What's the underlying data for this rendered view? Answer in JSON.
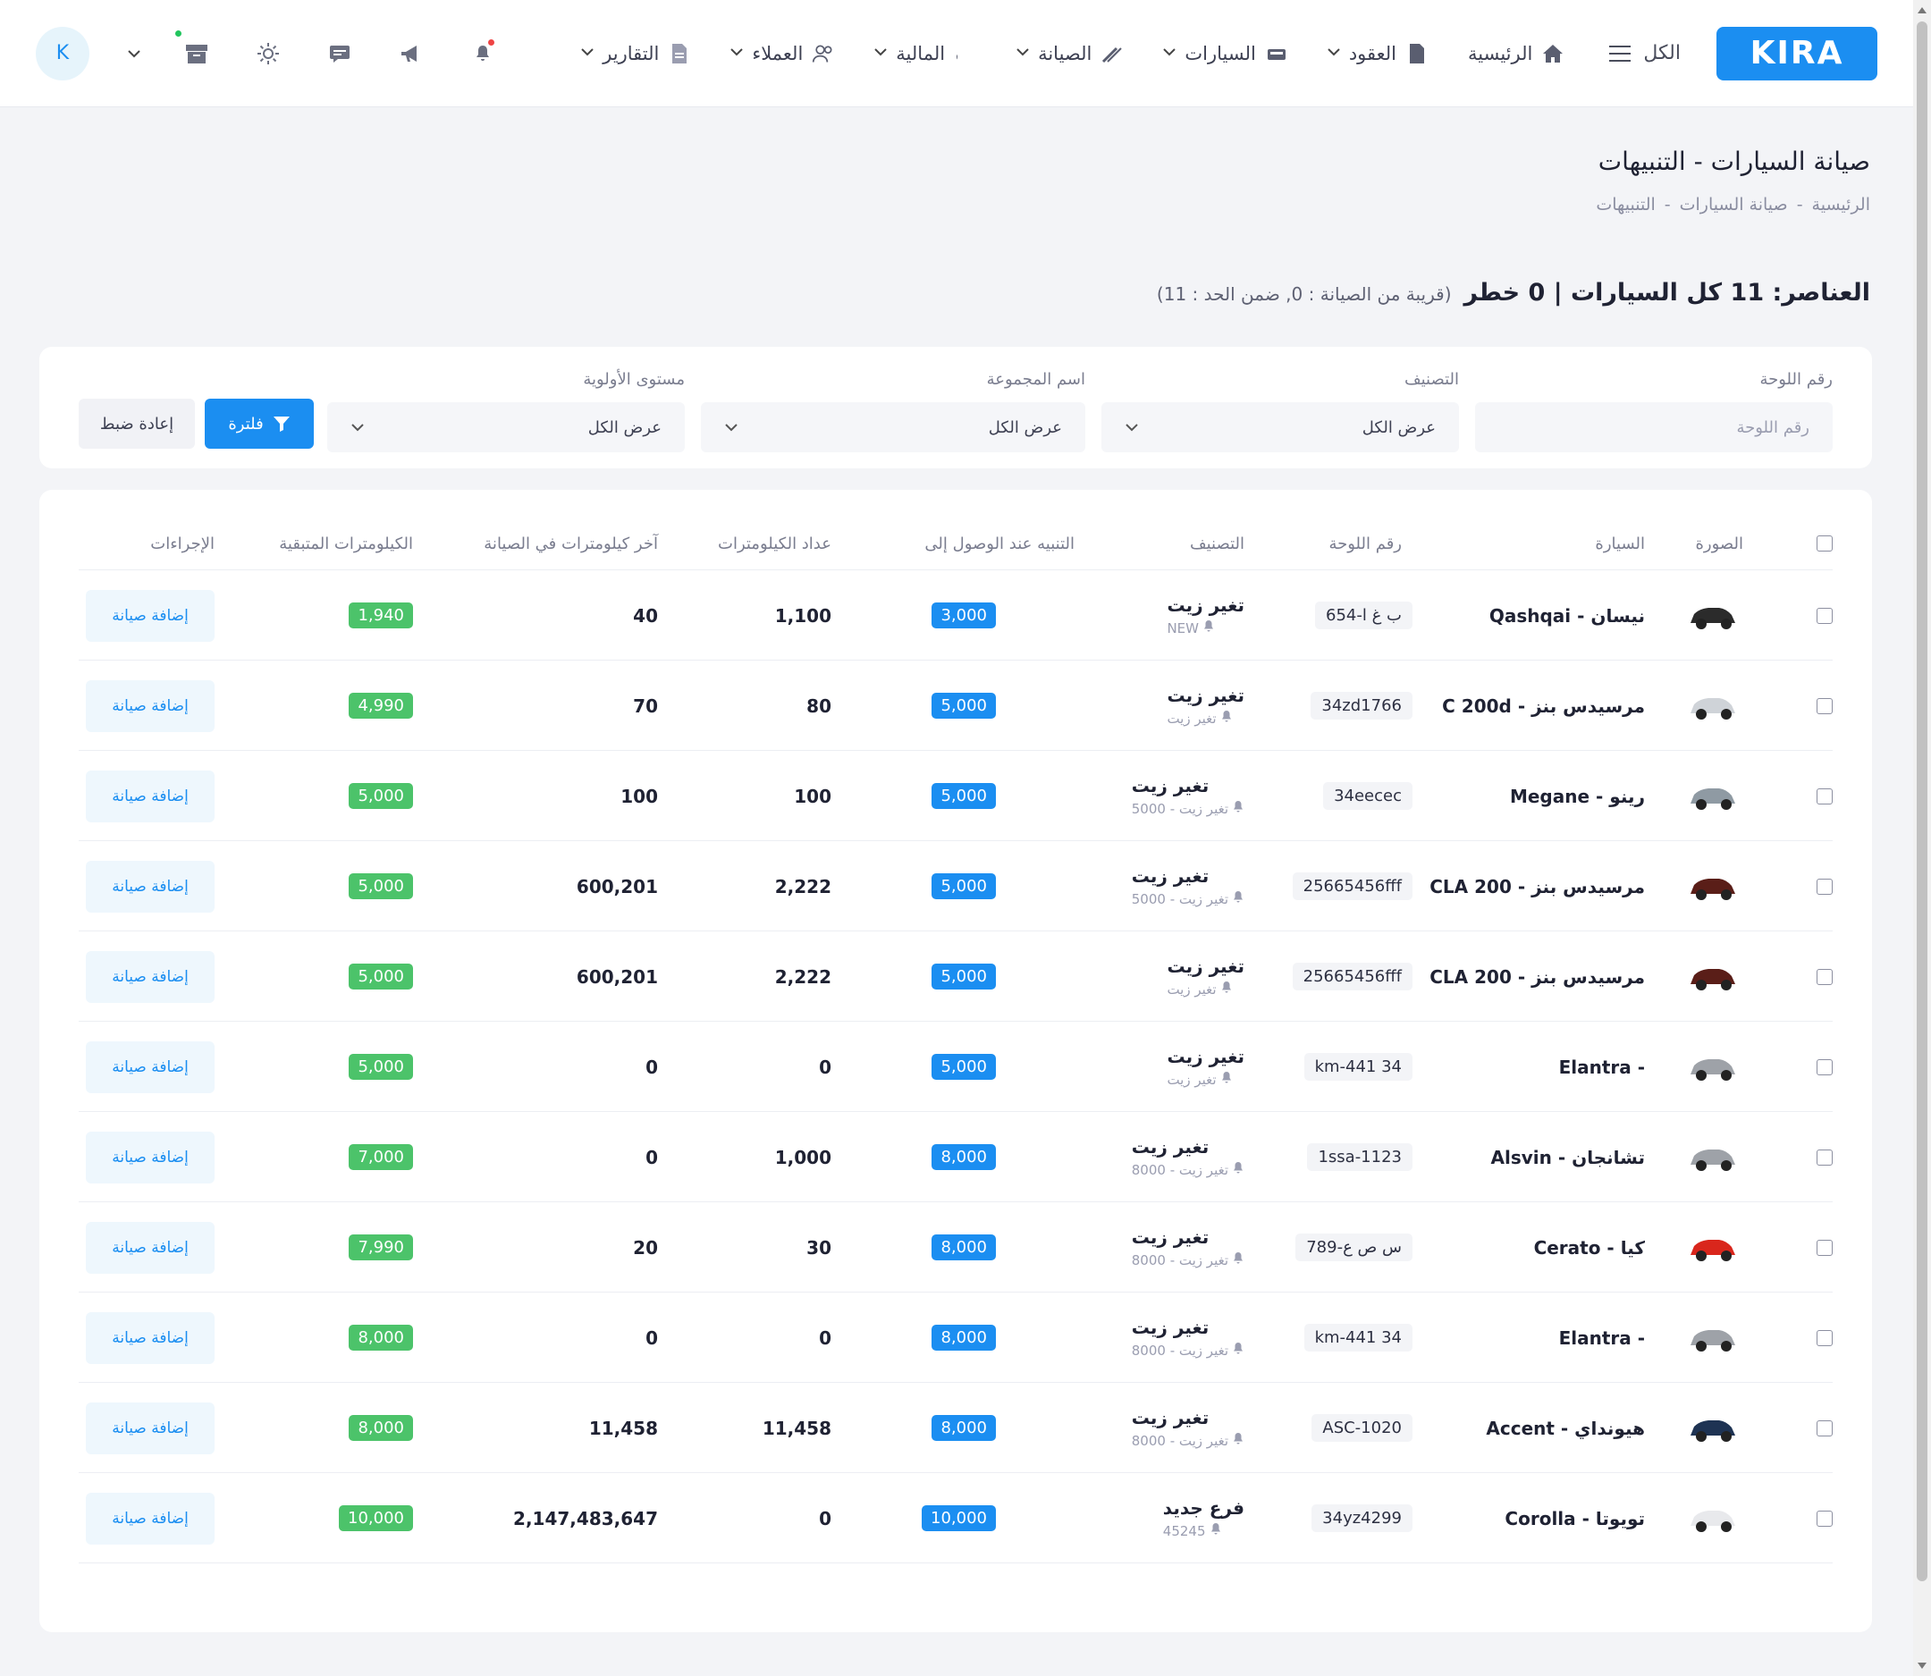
{
  "brand": {
    "logo": "KIRA",
    "accent": "#1b8ef1",
    "green": "#4cc36a"
  },
  "nav": {
    "all_label": "الكل",
    "items": [
      {
        "label": "الرئيسية",
        "icon": "home-icon",
        "has_menu": false
      },
      {
        "label": "العقود",
        "icon": "document-icon",
        "has_menu": true
      },
      {
        "label": "السيارات",
        "icon": "car-icon",
        "has_menu": true
      },
      {
        "label": "الصيانة",
        "icon": "wrench-icon",
        "has_menu": true
      },
      {
        "label": "المالية",
        "icon": "dollar-icon",
        "has_menu": true
      },
      {
        "label": "العملاء",
        "icon": "users-icon",
        "has_menu": true
      },
      {
        "label": "التقارير",
        "icon": "report-icon",
        "has_menu": true
      }
    ],
    "avatar_letter": "K"
  },
  "header": {
    "title": "صيانة السيارات - التنبيهات",
    "breadcrumb": [
      "الرئيسية",
      "صيانة السيارات",
      "التنبيهات"
    ],
    "breadcrumb_sep": "-",
    "summary_main": "العناصر: 11 كل السيارات | 0 خطر",
    "summary_sub": "(قريبة من الصيانة : 0, ضمن الحد : 11)"
  },
  "filters": {
    "plate": {
      "label": "رقم اللوحة",
      "placeholder": "رقم اللوحة"
    },
    "category": {
      "label": "التصنيف",
      "value": "عرض الكل"
    },
    "group": {
      "label": "اسم المجموعة",
      "value": "عرض الكل"
    },
    "priority": {
      "label": "مستوى الأولوية",
      "value": "عرض الكل"
    },
    "filter_button": "فلترة",
    "reset_button": "إعادة ضبط"
  },
  "table": {
    "columns": {
      "image": "الصورة",
      "car": "السيارة",
      "plate": "رقم اللوحة",
      "category": "التصنيف",
      "alert_at": "التنبيه عند الوصول إلى",
      "odometer": "عداد الكيلومترات",
      "last_service": "آخر كيلومترات في الصيانة",
      "remaining": "الكيلومترات المتبقية",
      "actions": "الإجراءات"
    },
    "action_label": "إضافة صيانة",
    "rows": [
      {
        "car": "نيسان - Qashqai",
        "plate": "ب غ ا-654",
        "cat": "تغير زيت",
        "sub": "NEW",
        "alert": "3,000",
        "odo": "1,100",
        "last": "40",
        "remain": "1,940",
        "color": "#2b2b2b"
      },
      {
        "car": "مرسيدس بنز - C 200d",
        "plate": "34zd1766",
        "cat": "تغير زيت",
        "sub": "تغير زيت",
        "alert": "5,000",
        "odo": "80",
        "last": "70",
        "remain": "4,990",
        "color": "#cfd3d8"
      },
      {
        "car": "رينو - Megane",
        "plate": "34eecec",
        "cat": "تغير زيت",
        "sub": "تغير زيت - 5000",
        "alert": "5,000",
        "odo": "100",
        "last": "100",
        "remain": "5,000",
        "color": "#8f9aa3"
      },
      {
        "car": "مرسيدس بنز - CLA 200",
        "plate": "25665456fff",
        "cat": "تغير زيت",
        "sub": "تغير زيت - 5000",
        "alert": "5,000",
        "odo": "2,222",
        "last": "600,201",
        "remain": "5,000",
        "color": "#5a1e18"
      },
      {
        "car": "مرسيدس بنز - CLA 200",
        "plate": "25665456fff",
        "cat": "تغير زيت",
        "sub": "تغير زيت",
        "alert": "5,000",
        "odo": "2,222",
        "last": "600,201",
        "remain": "5,000",
        "color": "#5a1e18"
      },
      {
        "car": "- Elantra",
        "plate": "km-441 34",
        "cat": "تغير زيت",
        "sub": "تغير زيت",
        "alert": "5,000",
        "odo": "0",
        "last": "0",
        "remain": "5,000",
        "color": "#9ea2a8"
      },
      {
        "car": "تشانجان - Alsvin",
        "plate": "1ssa-1123",
        "cat": "تغير زيت",
        "sub": "تغير زيت - 8000",
        "alert": "8,000",
        "odo": "1,000",
        "last": "0",
        "remain": "7,000",
        "color": "#9ea2a8"
      },
      {
        "car": "كيا - Cerato",
        "plate": "س ص ع-789",
        "cat": "تغير زيت",
        "sub": "تغير زيت - 8000",
        "alert": "8,000",
        "odo": "30",
        "last": "20",
        "remain": "7,990",
        "color": "#d9261c"
      },
      {
        "car": "- Elantra",
        "plate": "km-441 34",
        "cat": "تغير زيت",
        "sub": "تغير زيت - 8000",
        "alert": "8,000",
        "odo": "0",
        "last": "0",
        "remain": "8,000",
        "color": "#9ea2a8"
      },
      {
        "car": "هيونداي - Accent",
        "plate": "ASC-1020",
        "cat": "تغير زيت",
        "sub": "تغير زيت - 8000",
        "alert": "8,000",
        "odo": "11,458",
        "last": "11,458",
        "remain": "8,000",
        "color": "#1e3353"
      },
      {
        "car": "تويوتا - Corolla",
        "plate": "34yz4299",
        "cat": "فرع جديد",
        "sub": "45245",
        "alert": "10,000",
        "odo": "0",
        "last": "2,147,483,647",
        "remain": "10,000",
        "color": "#e8e9ec"
      }
    ]
  }
}
